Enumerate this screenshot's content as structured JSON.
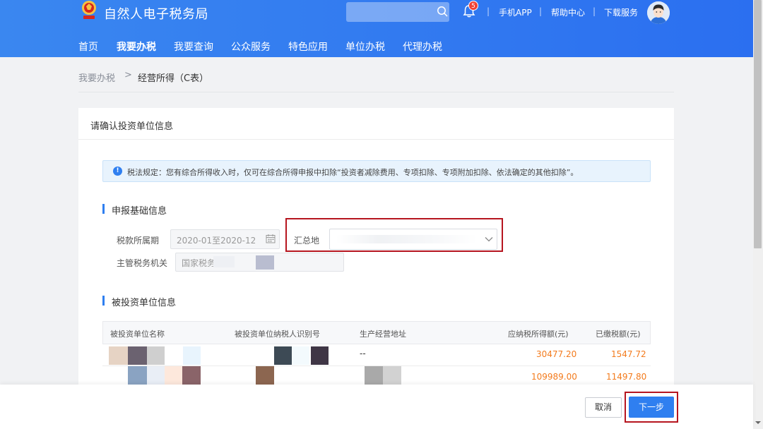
{
  "header": {
    "brand": "自然人电子税务局",
    "search": {
      "placeholder": ""
    },
    "notification_count": "5",
    "links": [
      "手机APP",
      "帮助中心",
      "下载服务"
    ],
    "separator": "|"
  },
  "nav": {
    "items": [
      "首页",
      "我要办税",
      "我要查询",
      "公众服务",
      "特色应用",
      "单位办税",
      "代理办税"
    ],
    "active": "我要办税"
  },
  "breadcrumb": {
    "parent": "我要办税",
    "separator": ">",
    "current": "经营所得（C表）"
  },
  "card": {
    "title": "请确认投资单位信息",
    "notice": "税法规定：您有综合所得收入时，仅可在综合所得申报中扣除“投资者减除费用、专项扣除、专项附加扣除、依法确定的其他扣除”。",
    "notice_icon": "!"
  },
  "basic_info": {
    "title": "申报基础信息",
    "period_label": "税款所属期",
    "period_value": "2020-01至2020-12",
    "summary_label": "汇总地",
    "authority_label": "主管税务机关",
    "authority_value": "国家税务"
  },
  "investees": {
    "title": "被投资单位信息",
    "columns": [
      "被投资单位名称",
      "被投资单位纳税人识别号",
      "生产经营地址",
      "应纳税所得额(元)",
      "已缴税额(元)"
    ],
    "rows": [
      {
        "address": "--",
        "taxable_income": "30477.20",
        "tax_paid": "1547.72"
      },
      {
        "address": "",
        "taxable_income": "109989.00",
        "tax_paid": "11497.80"
      }
    ]
  },
  "actions": {
    "cancel": "取消",
    "next": "下一步"
  },
  "colors": {
    "header_blue": "#2f7ff0",
    "amount_orange": "#f37b1d",
    "highlight_red": "#b6151f"
  }
}
